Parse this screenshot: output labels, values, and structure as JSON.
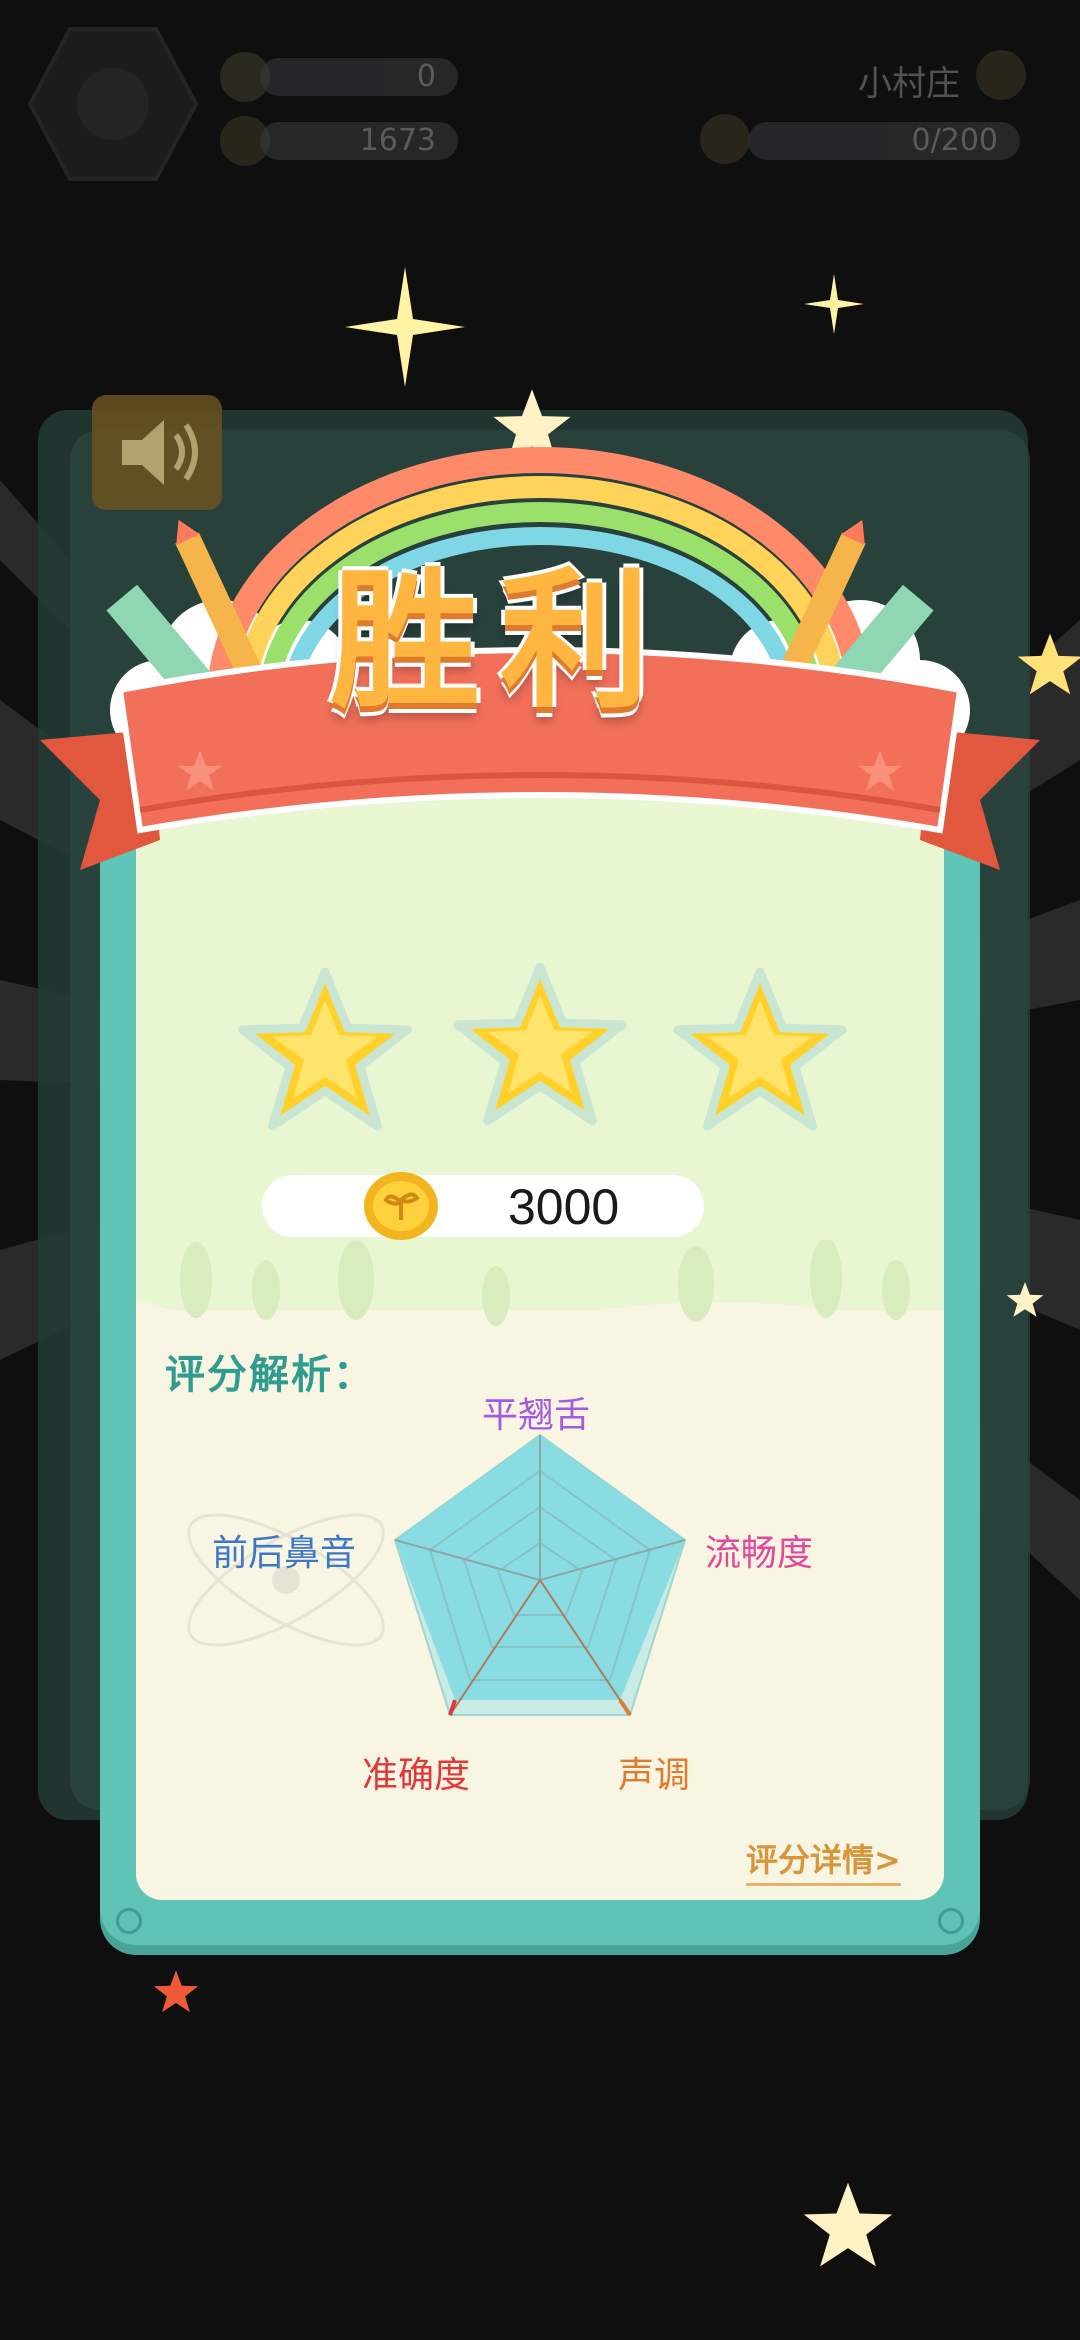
{
  "hud": {
    "stars_value": "0",
    "coins_value": "1673",
    "village_label": "小村庄",
    "progress_value": "0/200"
  },
  "result": {
    "title": "胜利",
    "stars_earned": 3,
    "stars_total": 3,
    "reward_coins": "3000"
  },
  "analysis": {
    "title": "评分解析：",
    "axes": [
      {
        "label": "平翘舌",
        "color": "#a45adf"
      },
      {
        "label": "流畅度",
        "color": "#e3499b"
      },
      {
        "label": "声调",
        "color": "#e07a2e"
      },
      {
        "label": "准确度",
        "color": "#e0373a"
      },
      {
        "label": "前后鼻音",
        "color": "#3d78c8"
      }
    ],
    "detail_link": "评分详情>"
  },
  "colors": {
    "accent_teal": "#5fc3b5",
    "banner_red": "#f2705a",
    "title_orange": "#ffb640"
  },
  "icons": [
    "avatar-icon",
    "star-icon",
    "coin-icon",
    "medal-icon",
    "cat-icon",
    "sound-icon",
    "sprout-coin-icon"
  ]
}
